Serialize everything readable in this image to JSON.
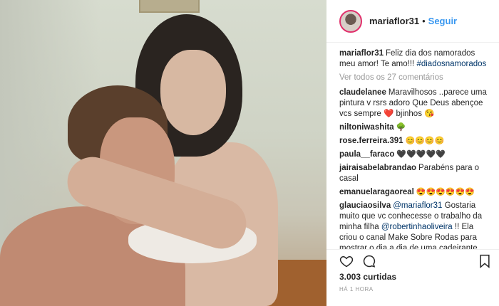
{
  "header": {
    "username": "mariaflor31",
    "dot": "•",
    "follow_label": "Seguir"
  },
  "caption": {
    "username": "mariaflor31",
    "text": "Feliz dia dos namorados meu amor! Te amo!!! ",
    "hashtag": "#diadosnamorados"
  },
  "view_all": "Ver todos os 27 comentários",
  "comments": [
    {
      "user": "claudelanee",
      "text": "Maravilhosos ..parece uma pintura v rsrs adoro Que Deus abençoe vcs sempre ❤️ bjinhos 😘"
    },
    {
      "user": "niltoniwashita",
      "text": "🌳"
    },
    {
      "user": "rose.ferreira.391",
      "text": "😊😊😊😊"
    },
    {
      "user": "paula__faraco",
      "text": "🖤🖤🖤🖤🖤"
    },
    {
      "user": "jairaisabelabrandao",
      "text": "Parabéns para o casal"
    },
    {
      "user": "emanuelaragaoreal",
      "text": "😍😍😍😍😍😍"
    },
    {
      "user": "glauciaosilva",
      "mention1": "@mariaflor31",
      "text1": " Gostaria muito que vc conhecesse o trabalho da minha filha ",
      "mention2": "@robertinhaoliveira",
      "text2": " !! Ela criou o canal Make Sobre Rodas para mostrar o dia a dia de uma cadeirante, também fala sobre superação, preconceito e das dicas de beleza!! Agradeceria muito se vc"
    }
  ],
  "likes": "3.003 curtidas",
  "time": "HÁ 1 HORA",
  "icons": {
    "like": "heart-icon",
    "comment": "comment-icon",
    "save": "bookmark-icon"
  }
}
